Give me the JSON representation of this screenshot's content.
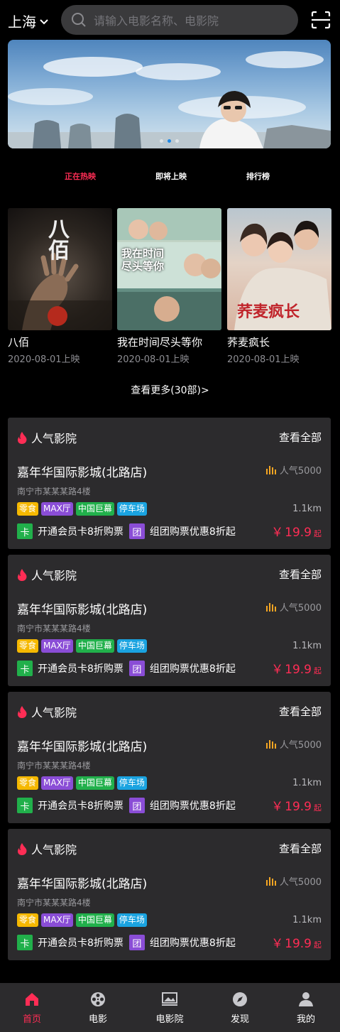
{
  "header": {
    "city": "上海",
    "search_placeholder": "请输入电影名称、电影院"
  },
  "banner": {
    "slides": 2,
    "active_slide": 1
  },
  "tabs": [
    {
      "label": "正在热映",
      "active": true
    },
    {
      "label": "即将上映",
      "active": false
    },
    {
      "label": "排行榜",
      "active": false
    }
  ],
  "movies": [
    {
      "title": "八佰",
      "date": "2020-08-01上映",
      "poster_text": "八佰"
    },
    {
      "title": "我在时间尽头等你",
      "date": "2020-08-01上映",
      "poster_text": "我在时间尽头等你"
    },
    {
      "title": "荞麦疯长",
      "date": "2020-08-01上映",
      "poster_text": "荞麦疯长"
    }
  ],
  "more_label": "查看更多(30部)>",
  "cinema_cards": [
    {
      "heading": "人气影院",
      "view_all": "查看全部",
      "name": "嘉年华国际影城(北路店)",
      "popularity": "人气5000",
      "address": "南宁市某某某路4楼",
      "tags": [
        {
          "label": "零食",
          "color": "#f5b800"
        },
        {
          "label": "MAX厅",
          "color": "#8a4dd6"
        },
        {
          "label": "中国巨幕",
          "color": "#21b04b"
        },
        {
          "label": "停车场",
          "color": "#1aa3e0"
        }
      ],
      "distance": "1.1km",
      "offer1_badge": "卡",
      "offer1_text": "开通会员卡8折购票",
      "offer2_badge": "团",
      "offer2_text": "组团购票优惠8折起",
      "price_currency": "￥",
      "price": "19.9",
      "price_suffix": "起"
    },
    {
      "heading": "人气影院",
      "view_all": "查看全部",
      "name": "嘉年华国际影城(北路店)",
      "popularity": "人气5000",
      "address": "南宁市某某某路4楼",
      "tags": [
        {
          "label": "零食",
          "color": "#f5b800"
        },
        {
          "label": "MAX厅",
          "color": "#8a4dd6"
        },
        {
          "label": "中国巨幕",
          "color": "#21b04b"
        },
        {
          "label": "停车场",
          "color": "#1aa3e0"
        }
      ],
      "distance": "1.1km",
      "offer1_badge": "卡",
      "offer1_text": "开通会员卡8折购票",
      "offer2_badge": "团",
      "offer2_text": "组团购票优惠8折起",
      "price_currency": "￥",
      "price": "19.9",
      "price_suffix": "起"
    },
    {
      "heading": "人气影院",
      "view_all": "查看全部",
      "name": "嘉年华国际影城(北路店)",
      "popularity": "人气5000",
      "address": "南宁市某某某路4楼",
      "tags": [
        {
          "label": "零食",
          "color": "#f5b800"
        },
        {
          "label": "MAX厅",
          "color": "#8a4dd6"
        },
        {
          "label": "中国巨幕",
          "color": "#21b04b"
        },
        {
          "label": "停车场",
          "color": "#1aa3e0"
        }
      ],
      "distance": "1.1km",
      "offer1_badge": "卡",
      "offer1_text": "开通会员卡8折购票",
      "offer2_badge": "团",
      "offer2_text": "组团购票优惠8折起",
      "price_currency": "￥",
      "price": "19.9",
      "price_suffix": "起"
    },
    {
      "heading": "人气影院",
      "view_all": "查看全部",
      "name": "嘉年华国际影城(北路店)",
      "popularity": "人气5000",
      "address": "南宁市某某某路4楼",
      "tags": [
        {
          "label": "零食",
          "color": "#f5b800"
        },
        {
          "label": "MAX厅",
          "color": "#8a4dd6"
        },
        {
          "label": "中国巨幕",
          "color": "#21b04b"
        },
        {
          "label": "停车场",
          "color": "#1aa3e0"
        }
      ],
      "distance": "1.1km",
      "offer1_badge": "卡",
      "offer1_text": "开通会员卡8折购票",
      "offer2_badge": "团",
      "offer2_text": "组团购票优惠8折起",
      "price_currency": "￥",
      "price": "19.9",
      "price_suffix": "起"
    }
  ],
  "nav": [
    {
      "label": "首页",
      "icon": "home-icon",
      "active": true
    },
    {
      "label": "电影",
      "icon": "film-reel-icon",
      "active": false
    },
    {
      "label": "电影院",
      "icon": "cinema-screen-icon",
      "active": false
    },
    {
      "label": "发现",
      "icon": "compass-icon",
      "active": false
    },
    {
      "label": "我的",
      "icon": "user-icon",
      "active": false
    }
  ],
  "colors": {
    "accent": "#ff2d55",
    "card_bg": "#2c2b2d",
    "offer1_badge": "#21b04b",
    "offer2_badge": "#8a4dd6",
    "popularity_icon": "#f5a623"
  }
}
